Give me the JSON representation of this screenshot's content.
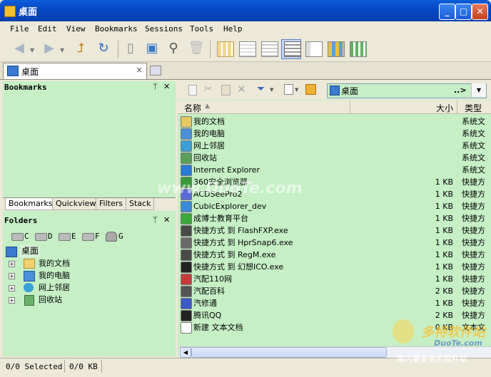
{
  "window": {
    "title": "桌面"
  },
  "menu": [
    "File",
    "Edit",
    "View",
    "Bookmarks",
    "Sessions",
    "Tools",
    "Help"
  ],
  "tab": {
    "label": "桌面",
    "close": "×"
  },
  "bookmarks_pane": {
    "title": "Bookmarks",
    "pin": "ᛘ",
    "close": "✕"
  },
  "pane_tabs": [
    "Bookmarks",
    "Quickview",
    "Filters",
    "Stack"
  ],
  "folders_pane": {
    "title": "Folders",
    "pin": "ᛘ",
    "close": "✕"
  },
  "drives": [
    "C",
    "D",
    "E",
    "F",
    "G"
  ],
  "tree": {
    "root": "桌面",
    "children": [
      "我的文档",
      "我的电脑",
      "网上邻居",
      "回收站"
    ]
  },
  "address": {
    "value": "桌面",
    "go": "..>"
  },
  "columns": {
    "name": "名称",
    "size": "大小",
    "type": "类型"
  },
  "files": [
    {
      "name": "我的文档",
      "size": "",
      "type": "系统文",
      "icon": "folder-icon",
      "color": "#e8c860"
    },
    {
      "name": "我的电脑",
      "size": "",
      "type": "系统文",
      "icon": "computer-icon",
      "color": "#4a90d8"
    },
    {
      "name": "网上邻居",
      "size": "",
      "type": "系统文",
      "icon": "network-icon",
      "color": "#3aa0d8"
    },
    {
      "name": "回收站",
      "size": "",
      "type": "系统文",
      "icon": "recycle-bin-icon",
      "color": "#5aa05a"
    },
    {
      "name": "Internet Explorer",
      "size": "",
      "type": "系统文",
      "icon": "ie-icon",
      "color": "#2a7ad8"
    },
    {
      "name": "360安全浏览器",
      "size": "1 KB",
      "type": "快捷方",
      "icon": "browser-icon",
      "color": "#3a9a3a"
    },
    {
      "name": "ACDSeePro2",
      "size": "1 KB",
      "type": "快捷方",
      "icon": "acdsee-icon",
      "color": "#5a6ad8"
    },
    {
      "name": "CubicExplorer_dev",
      "size": "1 KB",
      "type": "快捷方",
      "icon": "cube-icon",
      "color": "#3a8ad8"
    },
    {
      "name": "成博士教育平台",
      "size": "1 KB",
      "type": "快捷方",
      "icon": "education-icon",
      "color": "#3aaa3a"
    },
    {
      "name": "快捷方式 到 FlashFXP.exe",
      "size": "1 KB",
      "type": "快捷方",
      "icon": "shortcut-icon",
      "color": "#4a4a4a"
    },
    {
      "name": "快捷方式 到 HprSnap6.exe",
      "size": "1 KB",
      "type": "快捷方",
      "icon": "camera-icon",
      "color": "#6a6a6a"
    },
    {
      "name": "快捷方式 到 RegM.exe",
      "size": "1 KB",
      "type": "快捷方",
      "icon": "shortcut-icon",
      "color": "#4a4a4a"
    },
    {
      "name": "快捷方式 到 幻想ICO.exe",
      "size": "1 KB",
      "type": "快捷方",
      "icon": "penguin-icon",
      "color": "#222222"
    },
    {
      "name": "汽配110网",
      "size": "1 KB",
      "type": "快捷方",
      "icon": "car-icon",
      "color": "#c83a3a"
    },
    {
      "name": "汽配百科",
      "size": "2 KB",
      "type": "快捷方",
      "icon": "wiki-icon",
      "color": "#555555"
    },
    {
      "name": "汽修通",
      "size": "1 KB",
      "type": "快捷方",
      "icon": "repair-icon",
      "color": "#3a5ac8"
    },
    {
      "name": "腾讯QQ",
      "size": "2 KB",
      "type": "快捷方",
      "icon": "qq-icon",
      "color": "#222222"
    },
    {
      "name": "新建 文本文档",
      "size": "0 KB",
      "type": "文本文",
      "icon": "text-file-icon",
      "color": "#ffffff"
    }
  ],
  "status": {
    "selected": "0/0 Selected",
    "size": "0/0 KB"
  },
  "watermarks": {
    "center": "www.DuoTe.com",
    "corner_logo": "多特软件站",
    "corner_url": "DuoTe.com",
    "corner_slogan": "国内最安全的软件站"
  }
}
